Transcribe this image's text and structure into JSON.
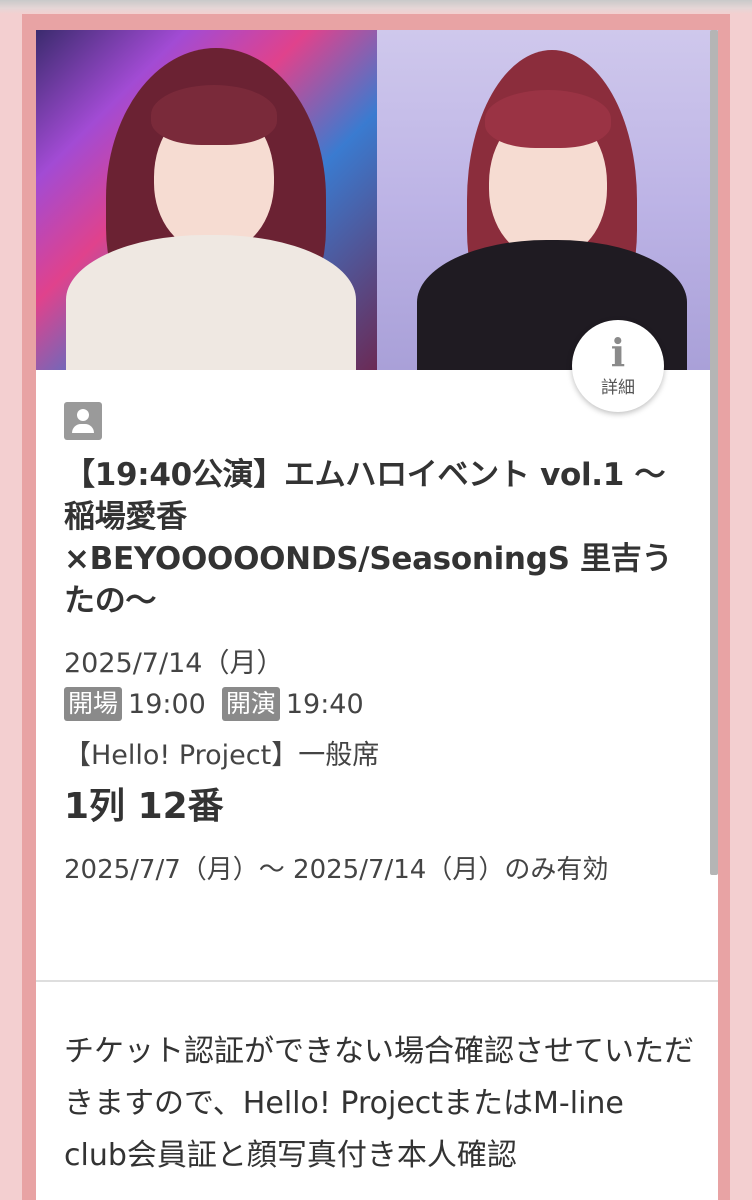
{
  "info_button": {
    "icon": "info-icon",
    "label": "詳細"
  },
  "user_icon": "person-icon",
  "event": {
    "title": "【19:40公演】エムハロイベント vol.1 〜稲場愛香 ×BEYOOOOONDS/SeasoningS 里吉うたの〜",
    "date": "2025/7/14（月）",
    "open_tag": "開場",
    "open_time": "19:00",
    "start_tag": "開演",
    "start_time": "19:40",
    "seat_type": "【Hello! Project】一般席",
    "seat_number": "1列 12番",
    "valid_period": "2025/7/7（月）～ 2025/7/14（月）のみ有効"
  },
  "notice": "チケット認証ができない場合確認させていただきますので、Hello! ProjectまたはM-line club会員証と顔写真付き本人確認",
  "colors": {
    "background": "#f3cfd0",
    "frame": "#e8a3a4",
    "tag_gray": "#8a8a8a"
  }
}
